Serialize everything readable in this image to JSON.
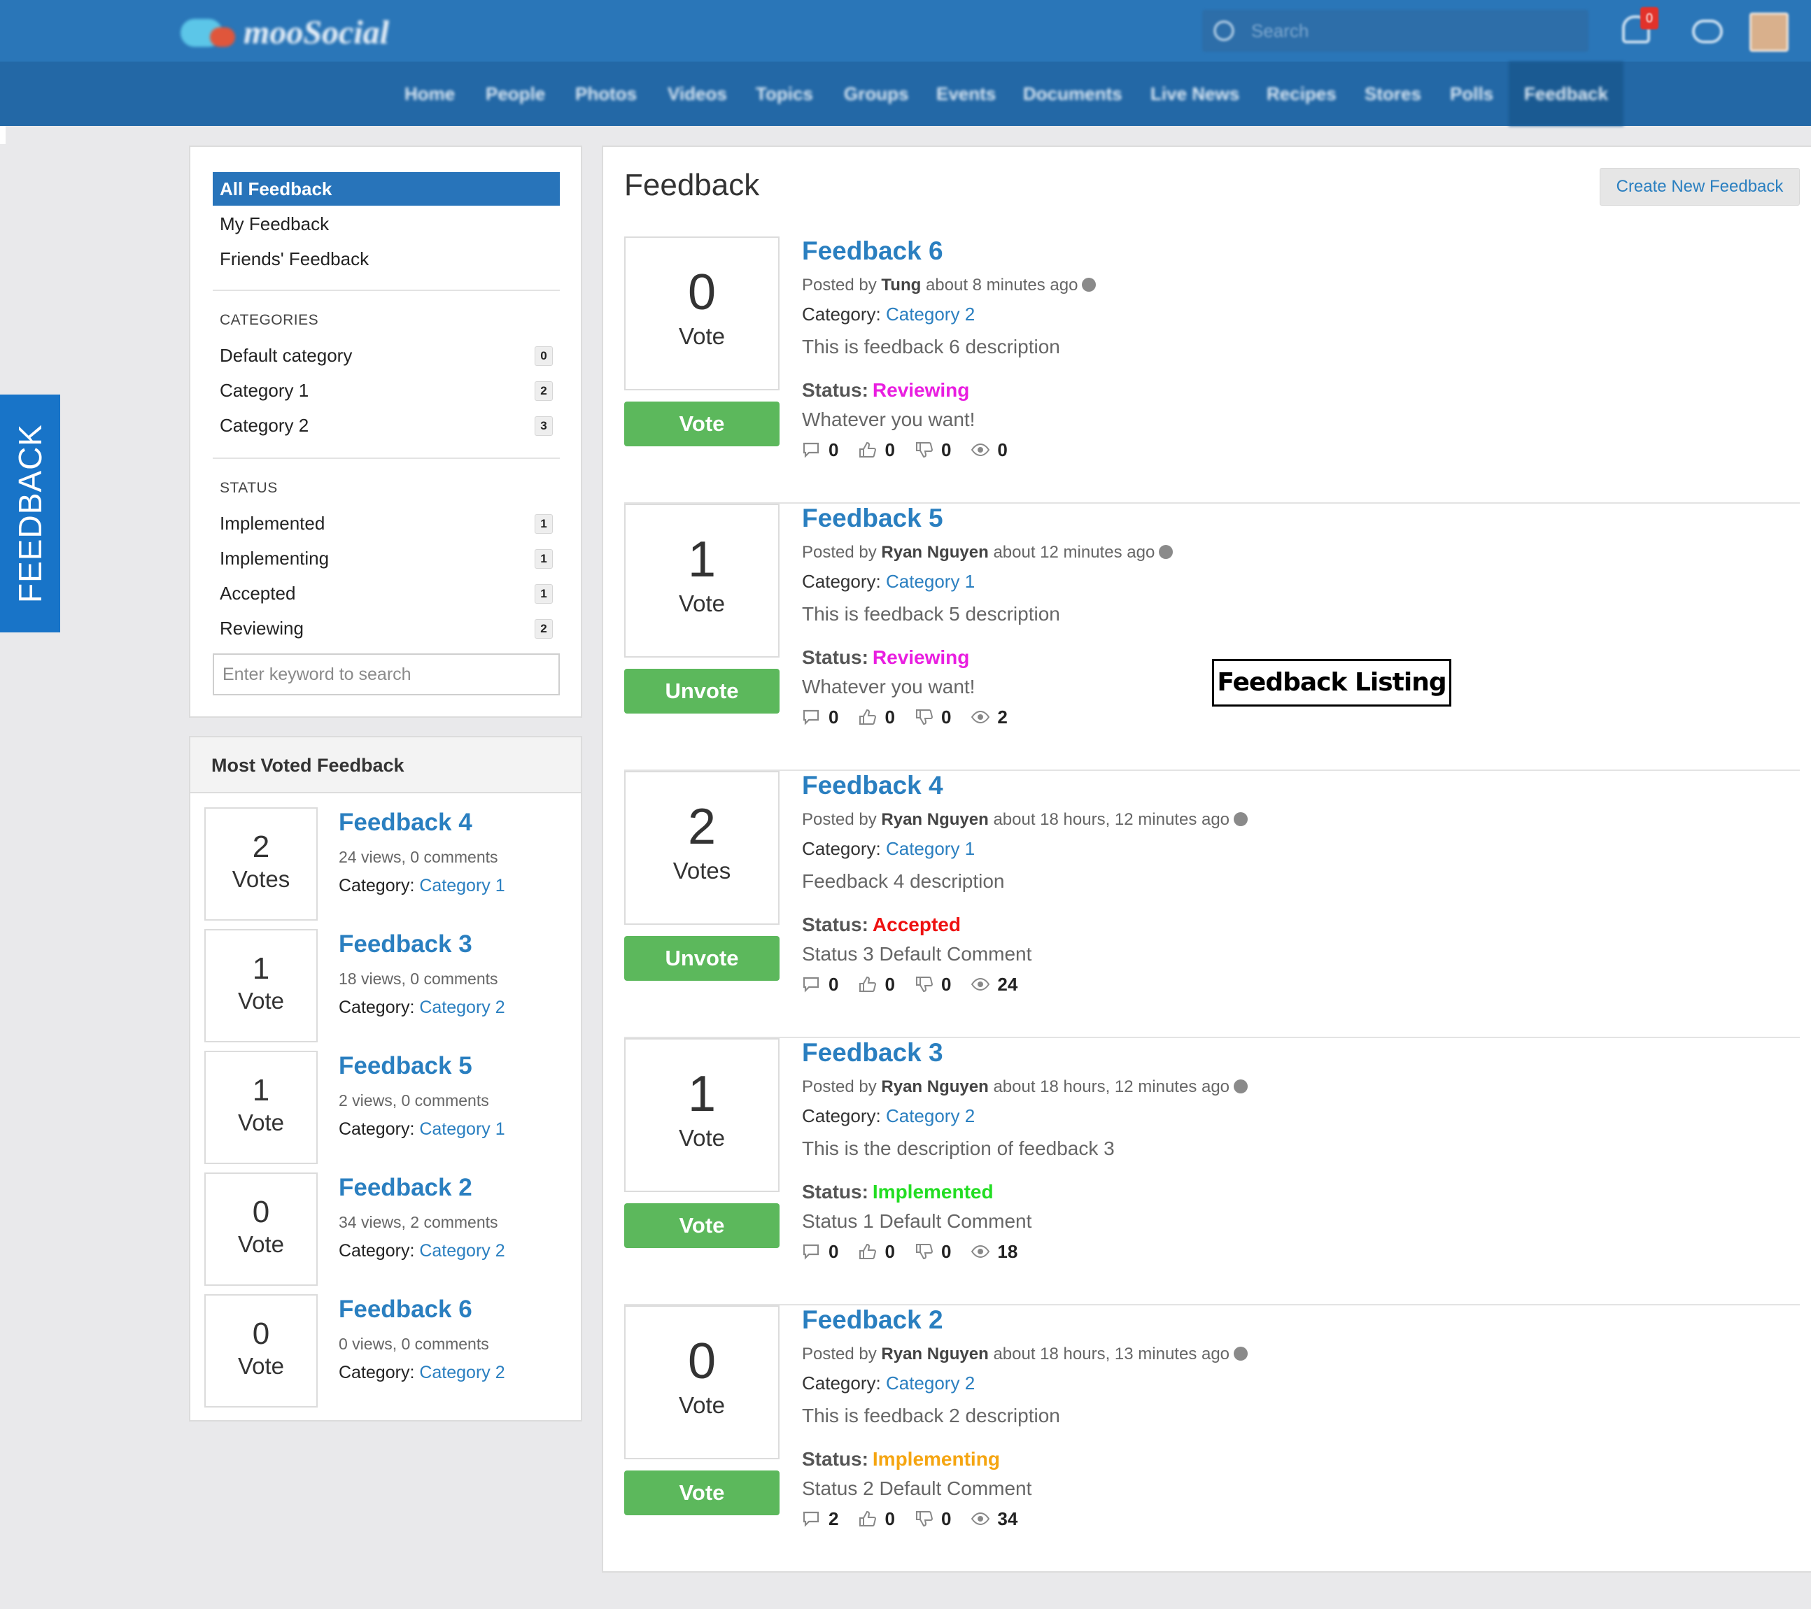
{
  "header": {
    "logo_text": "mooSocial",
    "search_placeholder": "Search",
    "notification_count": "0",
    "nav": [
      "Home",
      "People",
      "Photos",
      "Videos",
      "Topics",
      "Groups",
      "Events",
      "Documents",
      "Live News",
      "Recipes",
      "Stores",
      "Polls",
      "Feedback"
    ],
    "nav_active": "Feedback"
  },
  "side_tab": {
    "label": "FEEDBACK"
  },
  "filters": {
    "menu": [
      "All Feedback",
      "My Feedback",
      "Friends' Feedback"
    ],
    "categories_heading": "CATEGORIES",
    "categories": [
      {
        "label": "Default category",
        "count": "0"
      },
      {
        "label": "Category 1",
        "count": "2"
      },
      {
        "label": "Category 2",
        "count": "3"
      }
    ],
    "status_heading": "STATUS",
    "statuses": [
      {
        "label": "Implemented",
        "count": "1"
      },
      {
        "label": "Implementing",
        "count": "1"
      },
      {
        "label": "Accepted",
        "count": "1"
      },
      {
        "label": "Reviewing",
        "count": "2"
      }
    ],
    "search_placeholder": "Enter keyword to search"
  },
  "most_voted": {
    "title": "Most Voted Feedback",
    "category_prefix": "Category:",
    "items": [
      {
        "votes": "2",
        "vote_label": "Votes",
        "title": "Feedback 4",
        "meta": "24 views, 0 comments",
        "category": "Category 1"
      },
      {
        "votes": "1",
        "vote_label": "Vote",
        "title": "Feedback 3",
        "meta": "18 views, 0 comments",
        "category": "Category 2"
      },
      {
        "votes": "1",
        "vote_label": "Vote",
        "title": "Feedback 5",
        "meta": "2 views, 0 comments",
        "category": "Category 1"
      },
      {
        "votes": "0",
        "vote_label": "Vote",
        "title": "Feedback 2",
        "meta": "34 views, 2 comments",
        "category": "Category 2"
      },
      {
        "votes": "0",
        "vote_label": "Vote",
        "title": "Feedback 6",
        "meta": "0 views, 0 comments",
        "category": "Category 2"
      }
    ]
  },
  "main": {
    "title": "Feedback",
    "create_button": "Create New Feedback",
    "posted_by_prefix": "Posted by",
    "category_prefix": "Category:",
    "status_prefix": "Status:",
    "feedbacks": [
      {
        "votes": "0",
        "vote_label": "Vote",
        "button": "Vote",
        "title": "Feedback 6",
        "author": "Tung",
        "time": "about 8 minutes ago",
        "category": "Category 2",
        "description": "This is feedback 6 description",
        "status": "Reviewing",
        "status_color": "#e91ee0",
        "comment": "Whatever you want!",
        "comments": "0",
        "likes": "0",
        "dislikes": "0",
        "views": "0"
      },
      {
        "votes": "1",
        "vote_label": "Vote",
        "button": "Unvote",
        "title": "Feedback 5",
        "author": "Ryan Nguyen",
        "time": "about 12 minutes ago",
        "category": "Category 1",
        "description": "This is feedback 5 description",
        "status": "Reviewing",
        "status_color": "#e91ee0",
        "comment": "Whatever you want!",
        "comments": "0",
        "likes": "0",
        "dislikes": "0",
        "views": "2"
      },
      {
        "votes": "2",
        "vote_label": "Votes",
        "button": "Unvote",
        "title": "Feedback 4",
        "author": "Ryan Nguyen",
        "time": "about 18 hours, 12 minutes ago",
        "category": "Category 1",
        "description": "Feedback 4 description",
        "status": "Accepted",
        "status_color": "#ee1111",
        "comment": "Status 3 Default Comment",
        "comments": "0",
        "likes": "0",
        "dislikes": "0",
        "views": "24"
      },
      {
        "votes": "1",
        "vote_label": "Vote",
        "button": "Vote",
        "title": "Feedback 3",
        "author": "Ryan Nguyen",
        "time": "about 18 hours, 12 minutes ago",
        "category": "Category 2",
        "description": "This is the description of feedback 3",
        "status": "Implemented",
        "status_color": "#22dd22",
        "comment": "Status 1 Default Comment",
        "comments": "0",
        "likes": "0",
        "dislikes": "0",
        "views": "18"
      },
      {
        "votes": "0",
        "vote_label": "Vote",
        "button": "Vote",
        "title": "Feedback 2",
        "author": "Ryan Nguyen",
        "time": "about 18 hours, 13 minutes ago",
        "category": "Category 2",
        "description": "This is feedback 2 description",
        "status": "Implementing",
        "status_color": "#f5a511",
        "comment": "Status 2 Default Comment",
        "comments": "2",
        "likes": "0",
        "dislikes": "0",
        "views": "34"
      }
    ]
  },
  "annotation": {
    "label": "Feedback Listing"
  },
  "colors": {
    "brand_blue": "#2a76b8",
    "link_blue": "#2a7fc0",
    "vote_green": "#5cb85c",
    "side_tab_blue": "#1874c8"
  }
}
